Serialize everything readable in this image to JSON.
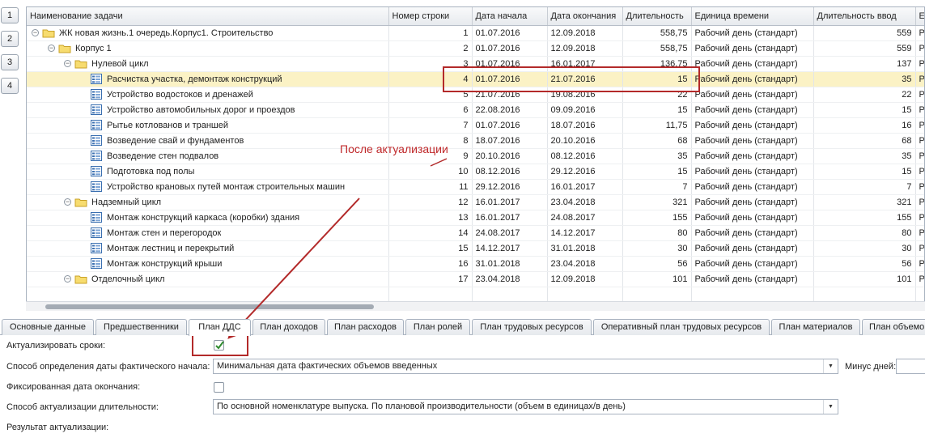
{
  "levels": [
    "1",
    "2",
    "3",
    "4"
  ],
  "columns": [
    "Наименование задачи",
    "Номер строки",
    "Дата начала",
    "Дата окончания",
    "Длительность",
    "Единица времени",
    "Длительность ввод",
    "Ед"
  ],
  "rows": [
    {
      "level": 0,
      "kind": "folder",
      "name": "ЖК новая жизнь.1 очередь.Корпус1. Строительство",
      "num": "1",
      "start": "01.07.2016",
      "end": "12.09.2018",
      "dur": "558,75",
      "unit": "Рабочий день (стандарт)",
      "dur_in": "559",
      "unit_in": "Ра"
    },
    {
      "level": 1,
      "kind": "folder",
      "name": "Корпус 1",
      "num": "2",
      "start": "01.07.2016",
      "end": "12.09.2018",
      "dur": "558,75",
      "unit": "Рабочий день (стандарт)",
      "dur_in": "559",
      "unit_in": "Ра"
    },
    {
      "level": 2,
      "kind": "folder",
      "name": "Нулевой цикл",
      "num": "3",
      "start": "01.07.2016",
      "end": "16.01.2017",
      "dur": "136,75",
      "unit": "Рабочий день (стандарт)",
      "dur_in": "137",
      "unit_in": "Ра"
    },
    {
      "level": 3,
      "kind": "task",
      "name": "Расчистка участка, демонтаж конструкций",
      "num": "4",
      "start": "01.07.2016",
      "end": "21.07.2016",
      "dur": "15",
      "unit": "Рабочий день (стандарт)",
      "dur_in": "35",
      "unit_in": "Ра",
      "selected": true
    },
    {
      "level": 3,
      "kind": "task",
      "name": "Устройство водостоков и дренажей",
      "num": "5",
      "start": "21.07.2016",
      "end": "19.08.2016",
      "dur": "22",
      "unit": "Рабочий день (стандарт)",
      "dur_in": "22",
      "unit_in": "Ра"
    },
    {
      "level": 3,
      "kind": "task",
      "name": "Устройство автомобильных дорог и проездов",
      "num": "6",
      "start": "22.08.2016",
      "end": "09.09.2016",
      "dur": "15",
      "unit": "Рабочий день (стандарт)",
      "dur_in": "15",
      "unit_in": "Ра"
    },
    {
      "level": 3,
      "kind": "task",
      "name": "Рытье котлованов и траншей",
      "num": "7",
      "start": "01.07.2016",
      "end": "18.07.2016",
      "dur": "11,75",
      "unit": "Рабочий день (стандарт)",
      "dur_in": "16",
      "unit_in": "Ра"
    },
    {
      "level": 3,
      "kind": "task",
      "name": "Возведение свай и фундаментов",
      "num": "8",
      "start": "18.07.2016",
      "end": "20.10.2016",
      "dur": "68",
      "unit": "Рабочий день (стандарт)",
      "dur_in": "68",
      "unit_in": "Ра"
    },
    {
      "level": 3,
      "kind": "task",
      "name": "Возведение стен подвалов",
      "num": "9",
      "start": "20.10.2016",
      "end": "08.12.2016",
      "dur": "35",
      "unit": "Рабочий день (стандарт)",
      "dur_in": "35",
      "unit_in": "Ра"
    },
    {
      "level": 3,
      "kind": "task",
      "name": "Подготовка под полы",
      "num": "10",
      "start": "08.12.2016",
      "end": "29.12.2016",
      "dur": "15",
      "unit": "Рабочий день (стандарт)",
      "dur_in": "15",
      "unit_in": "Ра"
    },
    {
      "level": 3,
      "kind": "task",
      "name": "Устройство крановых путей монтаж строительных машин",
      "num": "11",
      "start": "29.12.2016",
      "end": "16.01.2017",
      "dur": "7",
      "unit": "Рабочий день (стандарт)",
      "dur_in": "7",
      "unit_in": "Ра"
    },
    {
      "level": 2,
      "kind": "folder",
      "name": "Надземный цикл",
      "num": "12",
      "start": "16.01.2017",
      "end": "23.04.2018",
      "dur": "321",
      "unit": "Рабочий день (стандарт)",
      "dur_in": "321",
      "unit_in": "Ра"
    },
    {
      "level": 3,
      "kind": "task",
      "name": "Монтаж конструкций каркаса (коробки) здания",
      "num": "13",
      "start": "16.01.2017",
      "end": "24.08.2017",
      "dur": "155",
      "unit": "Рабочий день (стандарт)",
      "dur_in": "155",
      "unit_in": "Ра"
    },
    {
      "level": 3,
      "kind": "task",
      "name": "Монтаж стен и перегородок",
      "num": "14",
      "start": "24.08.2017",
      "end": "14.12.2017",
      "dur": "80",
      "unit": "Рабочий день (стандарт)",
      "dur_in": "80",
      "unit_in": "Ра"
    },
    {
      "level": 3,
      "kind": "task",
      "name": "Монтаж лестниц и перекрытий",
      "num": "15",
      "start": "14.12.2017",
      "end": "31.01.2018",
      "dur": "30",
      "unit": "Рабочий день (стандарт)",
      "dur_in": "30",
      "unit_in": "Ра"
    },
    {
      "level": 3,
      "kind": "task",
      "name": "Монтаж конструкций крыши",
      "num": "16",
      "start": "31.01.2018",
      "end": "23.04.2018",
      "dur": "56",
      "unit": "Рабочий день (стандарт)",
      "dur_in": "56",
      "unit_in": "Ра"
    },
    {
      "level": 2,
      "kind": "folder",
      "name": "Отделочный цикл",
      "num": "17",
      "start": "23.04.2018",
      "end": "12.09.2018",
      "dur": "101",
      "unit": "Рабочий день (стандарт)",
      "dur_in": "101",
      "unit_in": "Ра"
    }
  ],
  "annotation": {
    "text": "После актуализации"
  },
  "tabs": [
    {
      "label": "Основные данные"
    },
    {
      "label": "Предшественники"
    },
    {
      "label": "План ДДС",
      "active": true
    },
    {
      "label": "План доходов"
    },
    {
      "label": "План расходов"
    },
    {
      "label": "План ролей"
    },
    {
      "label": "План трудовых ресурсов"
    },
    {
      "label": "Оперативный план трудовых ресурсов"
    },
    {
      "label": "План материалов"
    },
    {
      "label": "План объемов"
    }
  ],
  "form": {
    "actualize_label": "Актуализировать сроки:",
    "actualize_checked": true,
    "start_method_label": "Способ определения даты фактического начала:",
    "start_method_value": "Минимальная дата фактических объемов введенных",
    "minus_days_label": "Минус дней:",
    "minus_days_value": "",
    "fixed_end_label": "Фиксированная дата окончания:",
    "fixed_end_checked": false,
    "duration_method_label": "Способ актуализации длительности:",
    "duration_method_value": "По основной номенклатуре выпуска. По плановой производительности (объем в единицах/в день)",
    "result_label": "Результат актуализации:"
  },
  "colors": {
    "annotation": "#b32a2a",
    "selected_row": "#fbf2c5",
    "check": "#2e8b2e"
  }
}
